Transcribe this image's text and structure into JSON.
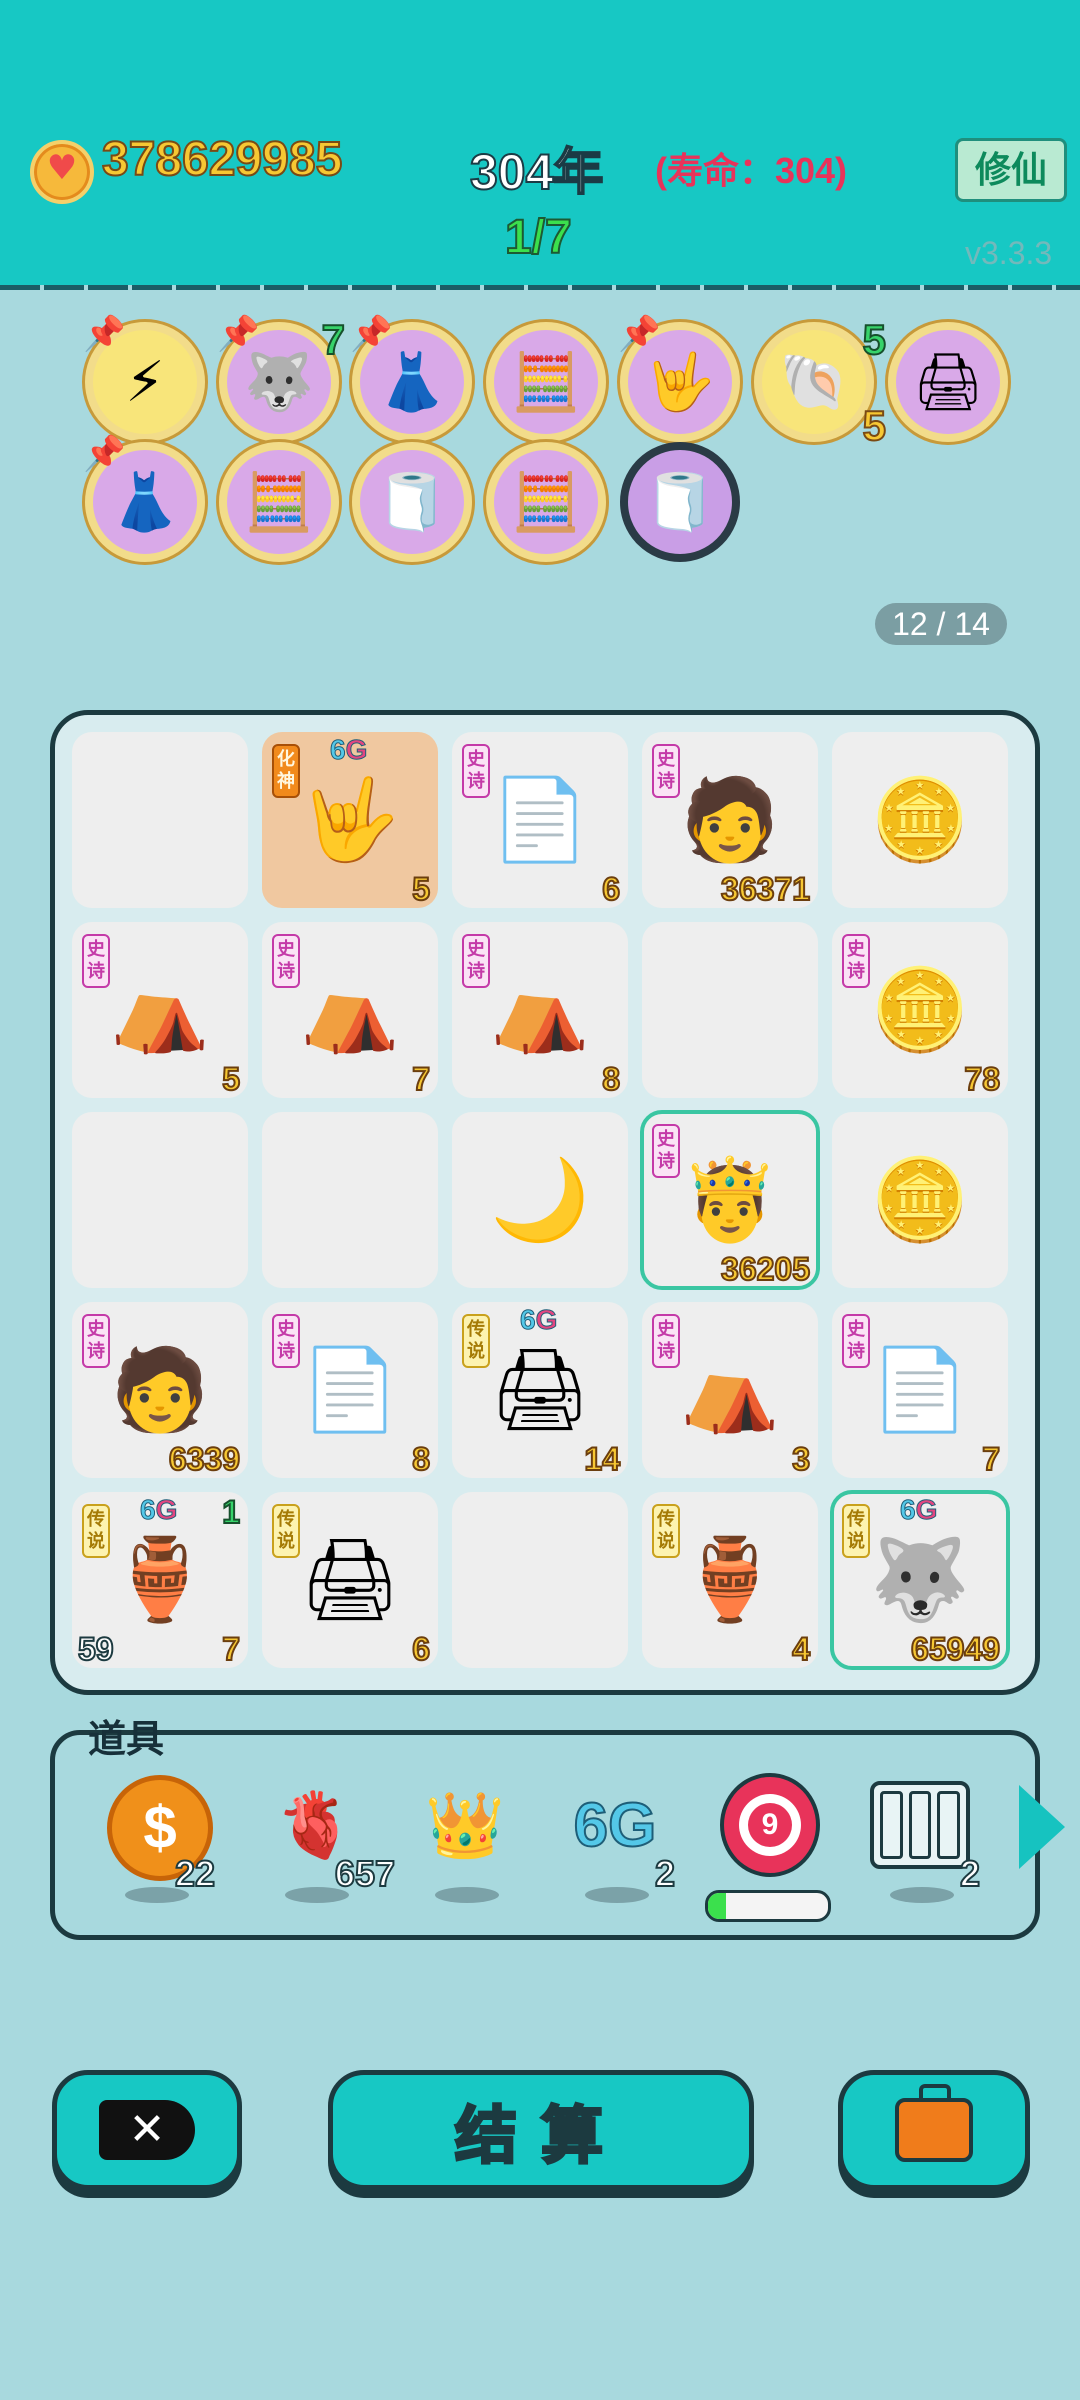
{
  "header": {
    "money": "378629985",
    "year": "304年",
    "lifespan": "(寿命：304)",
    "xiuxian_label": "修仙",
    "progress": "1/7",
    "version": "v3.3.3"
  },
  "collection": {
    "items": [
      {
        "icon": "lightning-icon",
        "glyph": "⚡",
        "pinned": true
      },
      {
        "icon": "husky-icon",
        "glyph": "🐺",
        "pinned": true,
        "count": "7"
      },
      {
        "icon": "skirt-icon",
        "glyph": "👗",
        "pinned": true
      },
      {
        "icon": "equation-avatar-icon",
        "glyph": "🧮",
        "pinned": false
      },
      {
        "icon": "rock-hand-icon",
        "glyph": "🤟",
        "pinned": true
      },
      {
        "icon": "shell-icon",
        "glyph": "🐚",
        "pinned": false,
        "count_top": "5",
        "count_bottom": "5"
      },
      {
        "icon": "printer-warning-icon",
        "glyph": "🖨",
        "pinned": false
      },
      {
        "icon": "skirt-icon",
        "glyph": "👗",
        "pinned": true
      },
      {
        "icon": "equation-avatar-icon",
        "glyph": "🧮",
        "pinned": false
      },
      {
        "icon": "tissue-box-icon",
        "glyph": "🧻",
        "pinned": false
      },
      {
        "icon": "equation-avatar-icon",
        "glyph": "🧮",
        "pinned": false
      },
      {
        "icon": "tissue-box-icon",
        "glyph": "🧻",
        "pinned": false
      }
    ],
    "page_counter": "12 / 14"
  },
  "board": {
    "cells": [
      {
        "empty": true
      },
      {
        "tag": "化神",
        "tag_style": "orange",
        "sixg": true,
        "icon": "rock-hand-icon",
        "glyph": "🤟",
        "num": "5",
        "bg": "orange"
      },
      {
        "tag": "史诗",
        "tag_style": "pink",
        "icon": "ctrl-cv-icon",
        "glyph": "📄",
        "num": "6"
      },
      {
        "tag": "史诗",
        "tag_style": "pink",
        "icon": "green-hair-guy-icon",
        "glyph": "🧑",
        "num": "36371"
      },
      {
        "icon": "coin-stack-icon",
        "glyph": "🪙"
      },
      {
        "tag": "史诗",
        "tag_style": "pink",
        "icon": "bunny-tent-icon",
        "glyph": "⛺",
        "num": "5"
      },
      {
        "tag": "史诗",
        "tag_style": "pink",
        "icon": "bunny-tent-icon",
        "glyph": "⛺",
        "num": "7"
      },
      {
        "tag": "史诗",
        "tag_style": "pink",
        "icon": "bunny-tent-icon",
        "glyph": "⛺",
        "num": "8"
      },
      {
        "empty": true
      },
      {
        "tag": "史诗",
        "tag_style": "pink",
        "icon": "coin-stack-icon",
        "glyph": "🪙",
        "num": "78"
      },
      {
        "empty": true
      },
      {
        "empty": true
      },
      {
        "icon": "moon-icon",
        "glyph": "🌙"
      },
      {
        "tag": "史诗",
        "tag_style": "pink",
        "icon": "crowned-guy-icon",
        "glyph": "🤴",
        "num": "36205",
        "highlight": true
      },
      {
        "icon": "coin-stack-icon",
        "glyph": "🪙"
      },
      {
        "tag": "史诗",
        "tag_style": "pink",
        "icon": "green-hair-guy-icon",
        "glyph": "🧑",
        "num": "6339"
      },
      {
        "tag": "史诗",
        "tag_style": "pink",
        "icon": "ctrl-cv-icon",
        "glyph": "📄",
        "num": "8"
      },
      {
        "tag": "传说",
        "tag_style": "yellow",
        "sixg": true,
        "icon": "printer-icon",
        "glyph": "🖨",
        "num": "14"
      },
      {
        "tag": "史诗",
        "tag_style": "pink",
        "icon": "bunny-tent-icon",
        "glyph": "⛺",
        "num": "3"
      },
      {
        "tag": "史诗",
        "tag_style": "pink",
        "icon": "ctrl-cv-icon",
        "glyph": "📄",
        "num": "7"
      },
      {
        "tag": "传说",
        "tag_style": "yellow",
        "sixg": true,
        "icon": "green-vase-icon",
        "glyph": "🏺",
        "num": "7",
        "num_left": "59",
        "num_green": "1"
      },
      {
        "tag": "传说",
        "tag_style": "yellow",
        "icon": "printer-icon",
        "glyph": "🖨",
        "num": "6"
      },
      {
        "empty": true
      },
      {
        "tag": "传说",
        "tag_style": "yellow",
        "icon": "green-vase-icon",
        "glyph": "🏺",
        "num": "4"
      },
      {
        "tag": "传说",
        "tag_style": "yellow",
        "sixg": true,
        "icon": "crowned-husky-icon",
        "glyph": "🐺",
        "num": "65949",
        "highlight": true
      }
    ]
  },
  "items": {
    "title": "道具",
    "list": [
      {
        "icon": "coin-icon",
        "count": "22"
      },
      {
        "icon": "liver-icon",
        "glyph": "🫀",
        "count": "657"
      },
      {
        "icon": "crown-icon",
        "glyph": "👑",
        "count": ""
      },
      {
        "icon": "6g-icon",
        "glyph": "6G",
        "count": "2"
      },
      {
        "icon": "target-icon",
        "glyph": "9",
        "count": "",
        "progress": 0.15
      },
      {
        "icon": "shelf-icon",
        "glyph": "▥",
        "count": "2"
      }
    ]
  },
  "buttons": {
    "settle_label": "结算",
    "close_glyph": "✕"
  }
}
